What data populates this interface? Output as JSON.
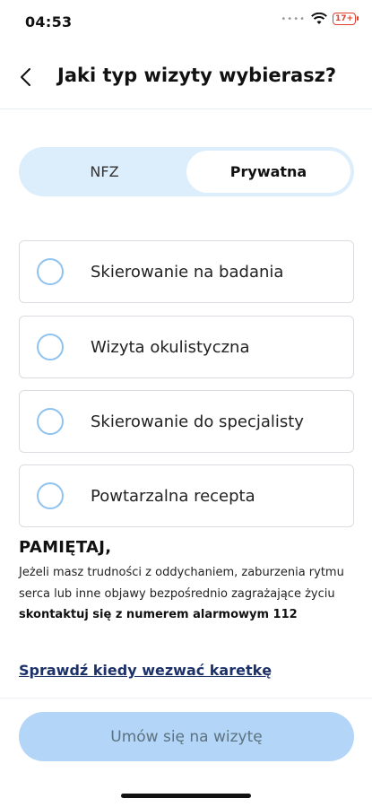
{
  "status_bar": {
    "time": "04:53",
    "battery": "17+"
  },
  "header": {
    "title": "Jaki typ wizyty wybierasz?"
  },
  "segmented": {
    "tabs": [
      {
        "label": "NFZ"
      },
      {
        "label": "Prywatna",
        "selected": true
      }
    ]
  },
  "options": [
    {
      "label": "Skierowanie na badania"
    },
    {
      "label": "Wizyta okulistyczna"
    },
    {
      "label": "Skierowanie do specjalisty"
    },
    {
      "label": "Powtarzalna recepta"
    }
  ],
  "notice": {
    "title": "PAMIĘTAJ,",
    "body": "Jeżeli masz trudności z oddychaniem, zaburzenia rytmu serca lub inne objawy bezpośrednio zagrażające życiu",
    "strong": "skontaktuj się z numerem alarmowym 112",
    "link": "Sprawdź kiedy wezwać karetkę"
  },
  "cta": {
    "label": "Umów się na wizytę"
  },
  "colors": {
    "accent": "#b3d5f8",
    "segment_bg": "#dcedfb",
    "radio": "#8fc3ef",
    "link": "#1c3168",
    "battery": "#e0402f"
  }
}
